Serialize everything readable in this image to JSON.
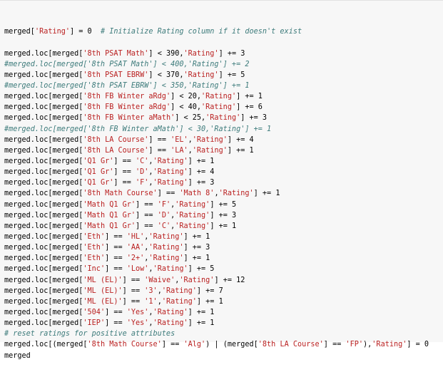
{
  "cell": {
    "lines": [
      "merged['Rating'] = 0  # Initialize Rating column if it doesn't exist",
      "",
      "merged.loc[merged['8th PSAT Math'] < 390,'Rating'] += 3",
      "#merged.loc[merged['8th PSAT Math'] < 400,'Rating'] += 2",
      "merged.loc[merged['8th PSAT EBRW'] < 370,'Rating'] += 5",
      "#merged.loc[merged['8th PSAT EBRW'] < 350,'Rating'] += 1",
      "merged.loc[merged['8th FB Winter aRdg'] < 20,'Rating'] += 1",
      "merged.loc[merged['8th FB Winter aRdg'] < 40,'Rating'] += 6",
      "merged.loc[merged['8th FB Winter aMath'] < 25,'Rating'] += 3",
      "#merged.loc[merged['8th FB Winter aMath'] < 30,'Rating'] += 1",
      "merged.loc[merged['8th LA Course'] == 'EL','Rating'] += 4",
      "merged.loc[merged['8th LA Course'] == 'LA','Rating'] += 1",
      "merged.loc[merged['Q1 Gr'] == 'C','Rating'] += 1",
      "merged.loc[merged['Q1 Gr'] == 'D','Rating'] += 4",
      "merged.loc[merged['Q1 Gr'] == 'F','Rating'] += 3",
      "merged.loc[merged['8th Math Course'] == 'Math 8','Rating'] += 1",
      "merged.loc[merged['Math Q1 Gr'] == 'F','Rating'] += 5",
      "merged.loc[merged['Math Q1 Gr'] == 'D','Rating'] += 3",
      "merged.loc[merged['Math Q1 Gr'] == 'C','Rating'] += 1",
      "merged.loc[merged['Eth'] == 'HL','Rating'] += 1",
      "merged.loc[merged['Eth'] == 'AA','Rating'] += 3",
      "merged.loc[merged['Eth'] == '2+','Rating'] += 1",
      "merged.loc[merged['Inc'] == 'Low','Rating'] += 5",
      "merged.loc[merged['ML (EL)'] == 'Waive','Rating'] += 12",
      "merged.loc[merged['ML (EL)'] == '3','Rating'] += 7",
      "merged.loc[merged['ML (EL)'] == '1','Rating'] += 1",
      "merged.loc[merged['504'] == 'Yes','Rating'] += 1",
      "merged.loc[merged['IEP'] == 'Yes','Rating'] += 1",
      "# reset ratings for positive attributes",
      "merged.loc[(merged['8th Math Course'] == 'Alg') | (merged['8th LA Course'] == 'FP'),'Rating'] = 0",
      "merged"
    ]
  },
  "colors": {
    "background": "#f7f7f7",
    "string": "#ba2121",
    "comment": "#3d7b7b",
    "text": "#000000"
  }
}
